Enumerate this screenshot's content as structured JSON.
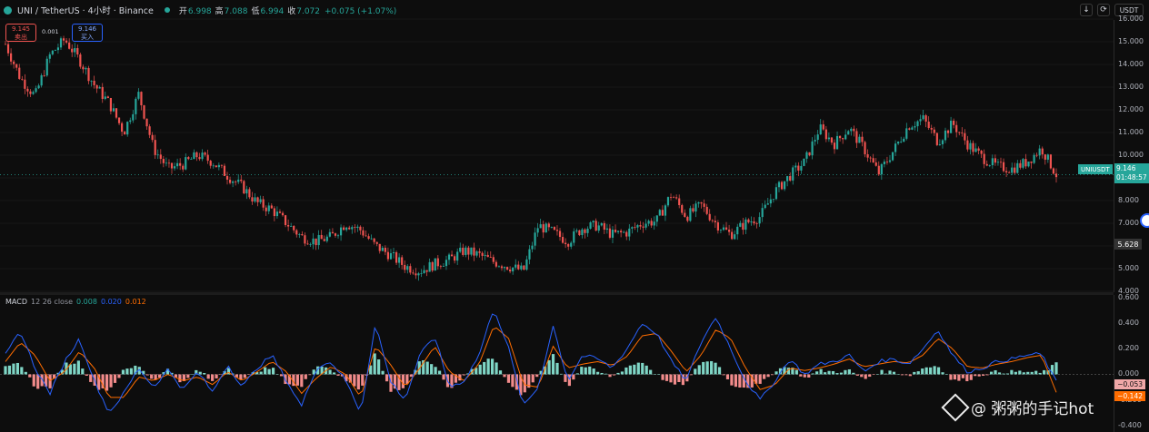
{
  "header": {
    "symbol": "UNI / TetherUS · 4小时 · Binance",
    "ohlc": [
      {
        "k": "开",
        "v": "6.998"
      },
      {
        "k": "高",
        "v": "7.088"
      },
      {
        "k": "低",
        "v": "6.994"
      },
      {
        "k": "收",
        "v": "7.072"
      },
      {
        "k": "",
        "v": "+0.075 (+1.07%)"
      }
    ],
    "currency": "USDT",
    "btn_down": "↓",
    "btn_refresh": "⟳"
  },
  "trade": {
    "sell_price": "9.145",
    "sell_label": "卖出",
    "spread": "0.001",
    "buy_price": "9.146",
    "buy_label": "买入"
  },
  "price_axis": [
    "16.000",
    "15.000",
    "14.000",
    "13.000",
    "12.000",
    "11.000",
    "10.000",
    "9.000",
    "8.000",
    "7.000",
    "6.000",
    "5.000",
    "4.000"
  ],
  "symbol_tag": "UNIUSDT",
  "last_price": "9.146",
  "countdown": "01:48:57",
  "marker_price": "5.628",
  "macd": {
    "label": "MACD",
    "params": "12 26 close",
    "v1": "0.008",
    "v2": "0.020",
    "v3": "0.012",
    "colors": {
      "v1": "#26a69a",
      "v2": "#2962ff",
      "v3": "#ff6d00"
    },
    "axis": [
      "0.600",
      "0.400",
      "0.200",
      "0.000",
      "-0.200",
      "-0.400"
    ],
    "hist_tag": "−0.053",
    "signal_tag": "−0.142"
  },
  "watermark": "@ 粥粥的手记hot",
  "colors": {
    "up": "#26a69a",
    "down": "#ef5350",
    "macd_line": "#2962ff",
    "signal_line": "#ff6d00"
  },
  "chart_data": {
    "type": "line",
    "title": "UNI / TetherUS · 4小时 · Binance",
    "ylim": [
      4,
      16
    ],
    "y": [
      14.9,
      13.4,
      12.6,
      14.4,
      15.1,
      14.2,
      13.1,
      12.3,
      11.0,
      12.7,
      10.3,
      9.4,
      9.6,
      10.0,
      9.7,
      9.1,
      8.6,
      7.9,
      7.6,
      7.0,
      6.4,
      6.2,
      6.4,
      7.0,
      6.7,
      6.0,
      5.6,
      5.1,
      4.9,
      5.2,
      5.4,
      5.8,
      5.6,
      5.3,
      5.1,
      4.9,
      6.9,
      6.6,
      6.2,
      6.8,
      6.9,
      6.5,
      6.6,
      7.0,
      7.1,
      8.3,
      7.3,
      7.8,
      7.0,
      6.5,
      7.0,
      7.3,
      8.4,
      9.1,
      9.7,
      11.2,
      10.5,
      11.2,
      10.3,
      9.2,
      10.2,
      11.3,
      11.6,
      10.6,
      11.4,
      10.5,
      9.9,
      9.5,
      9.4,
      9.7,
      10.3,
      9.146
    ],
    "macd_line": [
      0.15,
      0.34,
      0.05,
      -0.15,
      0.1,
      0.28,
      -0.05,
      -0.3,
      -0.15,
      0.05,
      -0.1,
      0.04,
      -0.12,
      0.02,
      -0.14,
      0.08,
      -0.1,
      0.05,
      0.15,
      -0.05,
      -0.25,
      0.05,
      0.1,
      -0.05,
      -0.3,
      0.4,
      -0.05,
      -0.2,
      0.15,
      0.3,
      -0.1,
      -0.05,
      0.15,
      0.52,
      0.2,
      -0.25,
      -0.1,
      0.38,
      -0.05,
      0.15,
      0.12,
      0.05,
      0.2,
      0.4,
      0.32,
      0.1,
      -0.05,
      0.25,
      0.45,
      0.2,
      -0.05,
      -0.2,
      -0.05,
      0.12,
      0.0,
      0.08,
      0.1,
      0.15,
      0.02,
      0.1,
      0.12,
      0.08,
      0.2,
      0.35,
      0.15,
      0.02,
      0.05,
      0.1,
      0.12,
      0.15,
      0.16,
      -0.06
    ],
    "signal_line": [
      0.1,
      0.25,
      0.15,
      -0.05,
      0.02,
      0.18,
      0.05,
      -0.18,
      -0.18,
      -0.02,
      -0.05,
      0.0,
      -0.05,
      -0.02,
      -0.08,
      0.02,
      -0.05,
      0.02,
      0.1,
      0.02,
      -0.15,
      -0.03,
      0.06,
      0.0,
      -0.18,
      0.22,
      0.08,
      -0.1,
      0.05,
      0.22,
      0.02,
      -0.05,
      0.08,
      0.38,
      0.28,
      -0.08,
      -0.1,
      0.22,
      0.05,
      0.08,
      0.1,
      0.07,
      0.14,
      0.3,
      0.32,
      0.18,
      0.02,
      0.15,
      0.35,
      0.28,
      0.05,
      -0.12,
      -0.08,
      0.05,
      0.03,
      0.05,
      0.08,
      0.12,
      0.06,
      0.08,
      0.1,
      0.09,
      0.15,
      0.28,
      0.2,
      0.06,
      0.05,
      0.08,
      0.1,
      0.13,
      0.15,
      -0.14
    ],
    "macd_ylim": [
      -0.45,
      0.62
    ]
  }
}
